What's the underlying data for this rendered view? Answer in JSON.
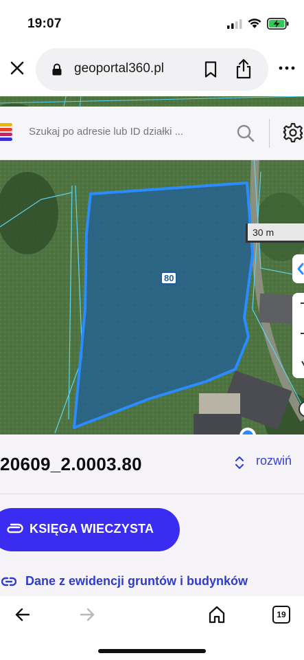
{
  "status_bar": {
    "time": "19:07"
  },
  "browser": {
    "url": "geoportal360.pl",
    "close_icon": "close-icon",
    "lock_icon": "lock-icon",
    "bookmark_icon": "bookmark-icon",
    "share_icon": "share-icon",
    "more_icon": "more-icon"
  },
  "search": {
    "placeholder": "Szukaj po adresie lub ID działki ...",
    "search_icon": "search-icon",
    "settings_icon": "gear-icon"
  },
  "map": {
    "scale_label": "30 m",
    "parcel_number": "80",
    "parcel_outline_color": "#2b8cff"
  },
  "parcel_panel": {
    "parcel_id": "20609_2.0003.80",
    "expand_label": "rozwiń",
    "kw_button_label": "KSIĘGA WIECZYSTA",
    "egib_link_label": "Dane z ewidencji gruntów i budynków",
    "accent_color": "#3a2cf0"
  },
  "bottom_toolbar": {
    "tabs_count": "19",
    "back_icon": "arrow-left-icon",
    "forward_icon": "arrow-right-icon",
    "home_icon": "home-icon",
    "tabs_icon": "tabs-icon"
  }
}
